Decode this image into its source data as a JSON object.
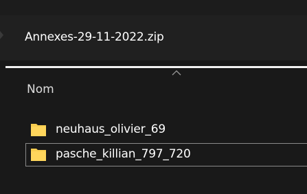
{
  "address_bar": {
    "path": "Annexes-29-11-2022.zip"
  },
  "column_header": {
    "name": "Nom",
    "sort_icon": "chevron-up-icon"
  },
  "files": [
    {
      "name": "neuhaus_olivier_69",
      "icon": "folder-icon",
      "selected": false
    },
    {
      "name": "pasche_killian_797_720",
      "icon": "folder-icon",
      "selected": true
    }
  ],
  "colors": {
    "background": "#191919",
    "folder": "#f8cd4f",
    "text": "#ffffff"
  }
}
